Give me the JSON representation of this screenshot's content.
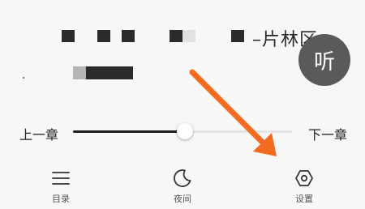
{
  "reader": {
    "title_tail": "–片林区",
    "listen_label": "听"
  },
  "progress": {
    "prev_label": "上一章",
    "next_label": "下一章",
    "value_percent": 51
  },
  "toolbar": {
    "items": [
      {
        "label": "目录",
        "icon": "menu-list-icon"
      },
      {
        "label": "夜间",
        "icon": "moon-icon"
      },
      {
        "label": "设置",
        "icon": "settings-hexagon-icon"
      }
    ]
  },
  "colors": {
    "background": "#f7f7f7",
    "text": "#222222",
    "listen_button": "#5a5a5a",
    "annotation_arrow": "#f26b21"
  }
}
